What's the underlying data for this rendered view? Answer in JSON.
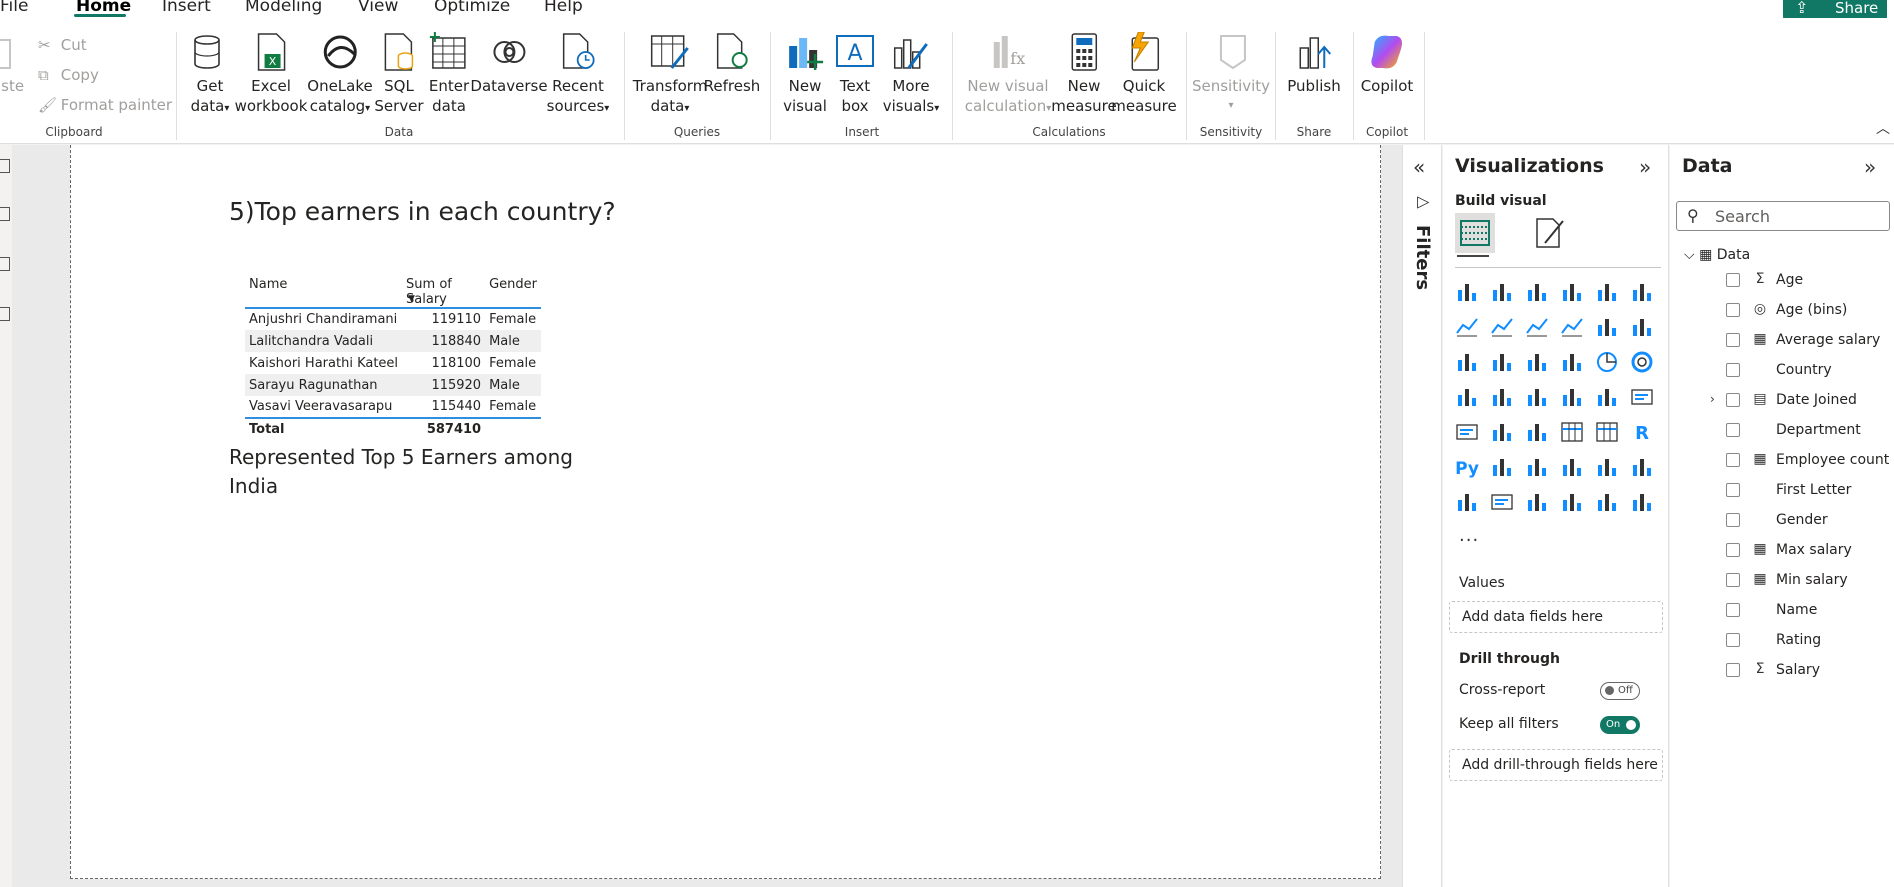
{
  "menu": {
    "items": [
      "File",
      "Home",
      "Insert",
      "Modeling",
      "View",
      "Optimize",
      "Help"
    ],
    "active": "Home",
    "share_label": "Share"
  },
  "ribbon": {
    "clipboard": {
      "paste": "aste",
      "cut": "Cut",
      "copy": "Copy",
      "format_painter": "Format painter",
      "label": "Clipboard"
    },
    "data_group": {
      "label": "Data",
      "get_data": [
        "Get",
        "data"
      ],
      "excel": [
        "Excel",
        "workbook"
      ],
      "onelake": [
        "OneLake",
        "catalog"
      ],
      "sql": [
        "SQL",
        "Server"
      ],
      "enter": [
        "Enter",
        "data"
      ],
      "dataverse": [
        "Dataverse"
      ],
      "recent": [
        "Recent",
        "sources"
      ]
    },
    "queries": {
      "label": "Queries",
      "transform": [
        "Transform",
        "data"
      ],
      "refresh": [
        "Refresh"
      ]
    },
    "insert": {
      "label": "Insert",
      "new_visual": [
        "New",
        "visual"
      ],
      "text_box": [
        "Text",
        "box"
      ],
      "more_visuals": [
        "More",
        "visuals"
      ]
    },
    "calculations": {
      "label": "Calculations",
      "new_visual_calc": [
        "New visual",
        "calculation"
      ],
      "new_measure": [
        "New",
        "measure"
      ],
      "quick_measure": [
        "Quick",
        "measure"
      ]
    },
    "sensitivity": {
      "label": "Sensitivity",
      "btn": [
        "Sensitivity"
      ]
    },
    "share": {
      "label": "Share",
      "publish": [
        "Publish"
      ]
    },
    "copilot": {
      "label": "Copilot",
      "btn": [
        "Copilot"
      ]
    }
  },
  "report": {
    "title": "5)Top earners in each country?",
    "table": {
      "headers": [
        "Name",
        "Sum of Salary",
        "Gender"
      ],
      "rows": [
        [
          "Anjushri Chandiramani",
          "119110",
          "Female"
        ],
        [
          "Lalitchandra Vadali",
          "118840",
          "Male"
        ],
        [
          "Kaishori Harathi Kateel",
          "118100",
          "Female"
        ],
        [
          "Sarayu Ragunathan",
          "115920",
          "Male"
        ],
        [
          "Vasavi Veeravasarapu",
          "115440",
          "Female"
        ]
      ],
      "total": [
        "Total",
        "587410",
        ""
      ]
    },
    "note": "Represented Top 5 Earners among India"
  },
  "filters": {
    "label": "Filters"
  },
  "visualizations": {
    "title": "Visualizations",
    "build_visual": "Build visual",
    "values_label": "Values",
    "values_placeholder": "Add data fields here",
    "drill_through": "Drill through",
    "cross_report": "Cross-report",
    "cross_report_state": "Off",
    "keep_all_filters": "Keep all filters",
    "keep_all_filters_state": "On",
    "drill_placeholder": "Add drill-through fields here",
    "more": "..."
  },
  "data_pane": {
    "title": "Data",
    "search_placeholder": "Search",
    "table_name": "Data",
    "fields": [
      {
        "name": "Age",
        "type": "sigma"
      },
      {
        "name": "Age (bins)",
        "type": "bins"
      },
      {
        "name": "Average salary",
        "type": "calc"
      },
      {
        "name": "Country",
        "type": "none"
      },
      {
        "name": "Date Joined",
        "type": "calendar"
      },
      {
        "name": "Department",
        "type": "none"
      },
      {
        "name": "Employee count",
        "type": "calc"
      },
      {
        "name": "First Letter",
        "type": "none"
      },
      {
        "name": "Gender",
        "type": "none"
      },
      {
        "name": "Max salary",
        "type": "calc"
      },
      {
        "name": "Min salary",
        "type": "calc"
      },
      {
        "name": "Name",
        "type": "none"
      },
      {
        "name": "Rating",
        "type": "none"
      },
      {
        "name": "Salary",
        "type": "sigma"
      }
    ]
  },
  "colors": {
    "accent": "#117865",
    "table_line": "#2f8ee0",
    "viz_blue": "#118dff"
  }
}
